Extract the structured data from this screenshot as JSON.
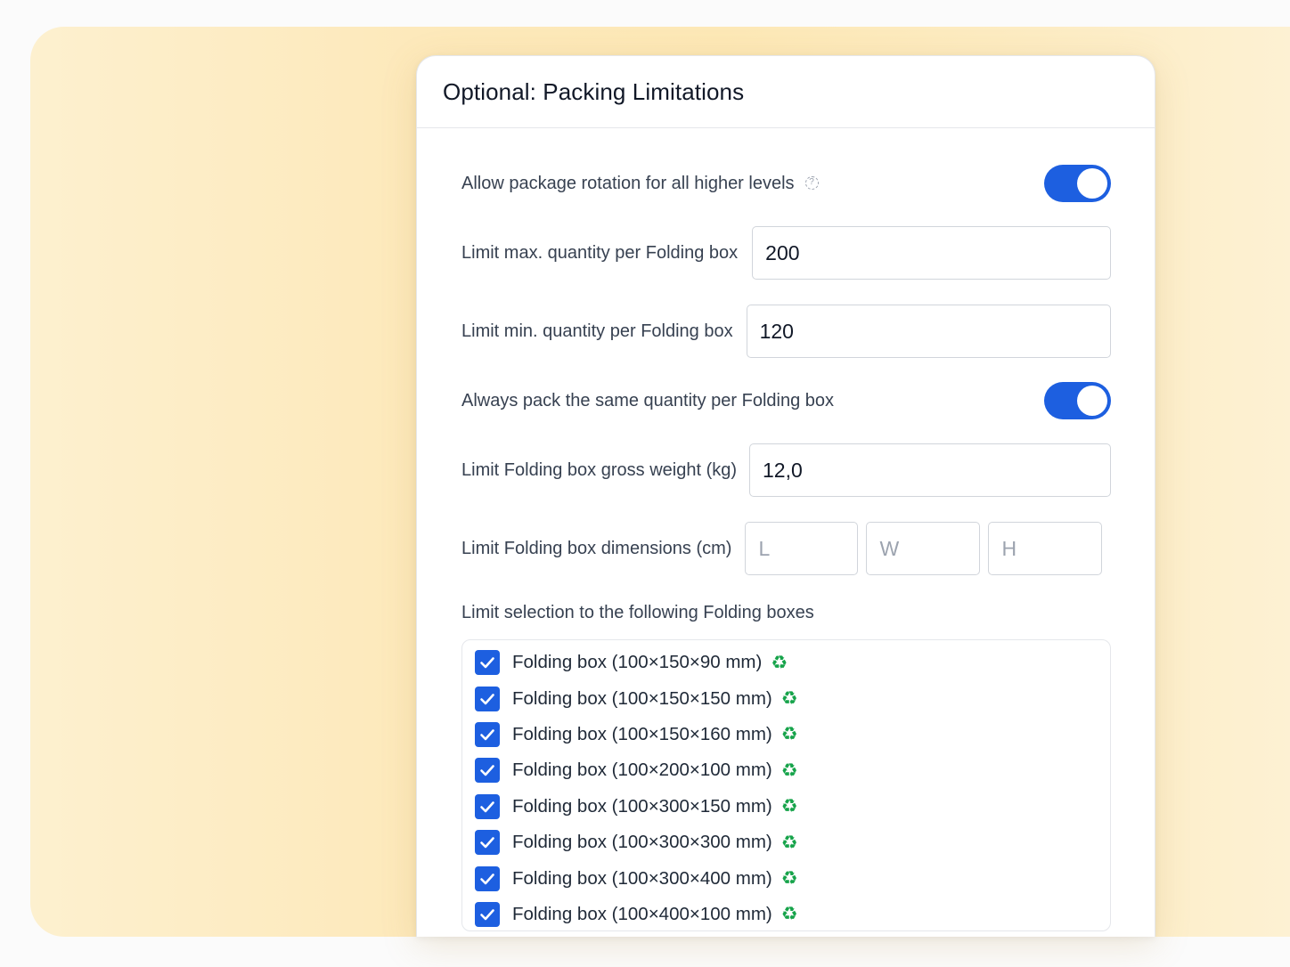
{
  "card": {
    "title": "Optional: Packing Limitations"
  },
  "settings": {
    "rotation": {
      "label": "Allow package rotation for all higher levels",
      "help_icon": "question-circle-icon",
      "enabled": true
    },
    "max_qty": {
      "label": "Limit max. quantity per Folding box",
      "value": "200"
    },
    "min_qty": {
      "label": "Limit min. quantity per Folding box",
      "value": "120"
    },
    "same_qty": {
      "label": "Always pack the same quantity per Folding box",
      "enabled": true
    },
    "gross_weight": {
      "label": "Limit Folding box gross weight (kg)",
      "value": "12,0"
    },
    "dimensions": {
      "label": "Limit Folding box dimensions (cm)",
      "length_placeholder": "L",
      "width_placeholder": "W",
      "height_placeholder": "H"
    }
  },
  "selection": {
    "label": "Limit selection to the following Folding boxes",
    "items": [
      {
        "label": "Folding box (100×150×90 mm)",
        "checked": true,
        "icon": "recycle-icon"
      },
      {
        "label": "Folding box (100×150×150 mm)",
        "checked": true,
        "icon": "recycle-icon"
      },
      {
        "label": "Folding box (100×150×160 mm)",
        "checked": true,
        "icon": "recycle-icon"
      },
      {
        "label": "Folding box (100×200×100 mm)",
        "checked": true,
        "icon": "recycle-icon"
      },
      {
        "label": "Folding box (100×300×150 mm)",
        "checked": true,
        "icon": "recycle-icon"
      },
      {
        "label": "Folding box (100×300×300 mm)",
        "checked": true,
        "icon": "recycle-icon"
      },
      {
        "label": "Folding box (100×300×400 mm)",
        "checked": true,
        "icon": "recycle-icon"
      },
      {
        "label": "Folding box (100×400×100 mm)",
        "checked": true,
        "icon": "recycle-icon"
      }
    ]
  },
  "colors": {
    "accent": "#1d5fe0",
    "recycle": "#16a34a",
    "background": "#fde8b6"
  }
}
